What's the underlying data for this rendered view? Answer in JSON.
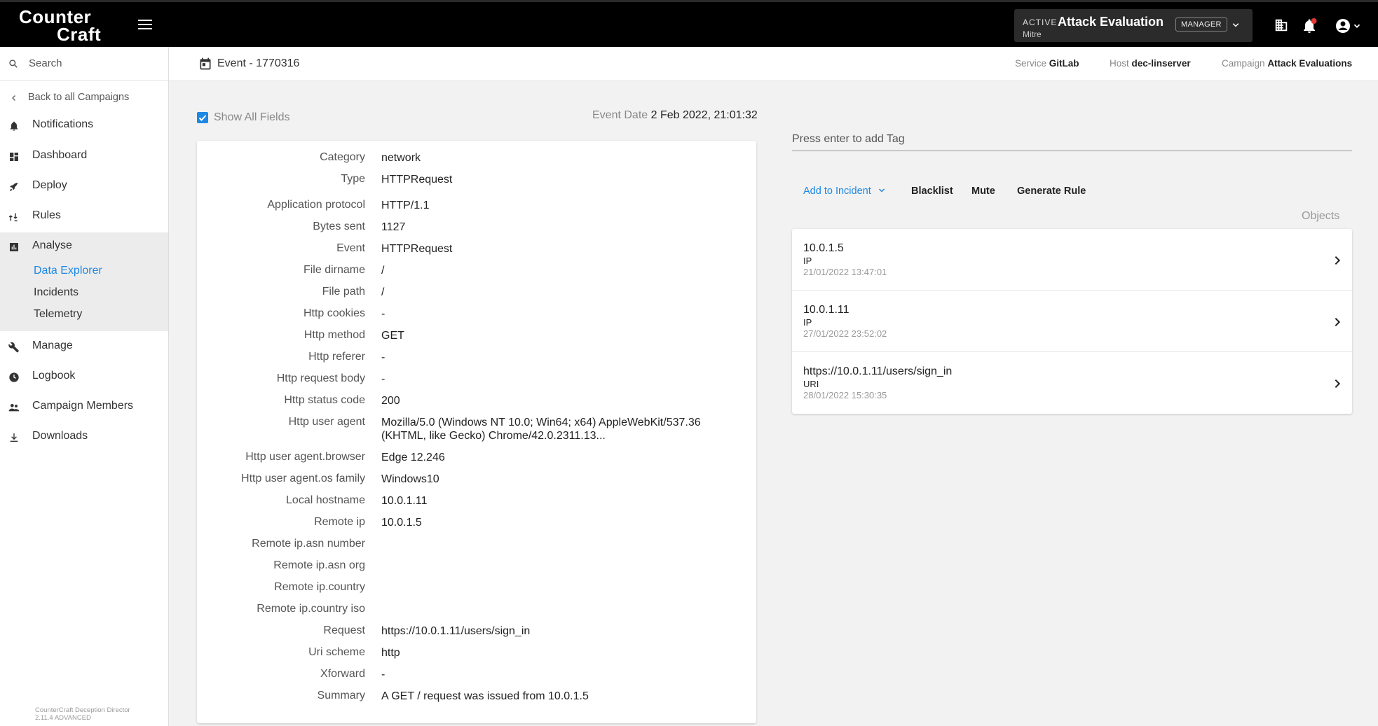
{
  "app": {
    "logo_line1": "Counter",
    "logo_line2": "Craft",
    "version_line1": "CounterCraft Deception Director",
    "version_line2": "2.11.4 ADVANCED"
  },
  "campaign": {
    "status": "ACTIVE",
    "name": "Attack Evaluations",
    "org": "Mitre",
    "role": "MANAGER"
  },
  "sidebar": {
    "search_label": "Search",
    "back_label": "Back to all Campaigns",
    "items": [
      {
        "label": "Notifications",
        "icon": "bell-icon"
      },
      {
        "label": "Dashboard",
        "icon": "dashboard-icon"
      },
      {
        "label": "Deploy",
        "icon": "rocket-icon"
      },
      {
        "label": "Rules",
        "icon": "rules-icon"
      },
      {
        "label": "Analyse",
        "icon": "chart-icon"
      },
      {
        "label": "Manage",
        "icon": "wrench-icon"
      },
      {
        "label": "Logbook",
        "icon": "clock-icon"
      },
      {
        "label": "Campaign Members",
        "icon": "people-icon"
      },
      {
        "label": "Downloads",
        "icon": "download-icon"
      }
    ],
    "analyse_sub": [
      "Data Explorer",
      "Incidents",
      "Telemetry"
    ]
  },
  "header": {
    "title": "Event - 1770316",
    "service_label": "Service",
    "service_value": "GitLab",
    "host_label": "Host",
    "host_value": "dec-linserver",
    "campaign_label": "Campaign",
    "campaign_value": "Attack Evaluations"
  },
  "event": {
    "show_all_fields": "Show All Fields",
    "date_label": "Event Date",
    "date_value": "2 Feb 2022, 21:01:32"
  },
  "fields": [
    {
      "label": "Category",
      "value": "network"
    },
    {
      "label": "Type",
      "value": "HTTPRequest"
    },
    {
      "label": "Application protocol",
      "value": "HTTP/1.1"
    },
    {
      "label": "Bytes sent",
      "value": "1127"
    },
    {
      "label": "Event",
      "value": "HTTPRequest"
    },
    {
      "label": "File dirname",
      "value": "/"
    },
    {
      "label": "File path",
      "value": "/"
    },
    {
      "label": "Http cookies",
      "value": "-"
    },
    {
      "label": "Http method",
      "value": "GET"
    },
    {
      "label": "Http referer",
      "value": "-"
    },
    {
      "label": "Http request body",
      "value": "-"
    },
    {
      "label": "Http status code",
      "value": "200"
    },
    {
      "label": "Http user agent",
      "value": "Mozilla/5.0 (Windows NT 10.0; Win64; x64) AppleWebKit/537.36 (KHTML, like Gecko) Chrome/42.0.2311.13..."
    },
    {
      "label": "Http user agent.browser",
      "value": "Edge 12.246"
    },
    {
      "label": "Http user agent.os family",
      "value": "Windows10"
    },
    {
      "label": "Local hostname",
      "value": "10.0.1.11"
    },
    {
      "label": "Remote ip",
      "value": "10.0.1.5"
    },
    {
      "label": "Remote ip.asn number",
      "value": ""
    },
    {
      "label": "Remote ip.asn org",
      "value": ""
    },
    {
      "label": "Remote ip.country",
      "value": ""
    },
    {
      "label": "Remote ip.country iso",
      "value": ""
    },
    {
      "label": "Request",
      "value": "https://10.0.1.11/users/sign_in"
    },
    {
      "label": "Uri scheme",
      "value": "http"
    },
    {
      "label": "Xforward",
      "value": "-"
    },
    {
      "label": "Summary",
      "value": "A GET / request was issued from 10.0.1.5"
    }
  ],
  "right": {
    "tag_placeholder": "Press enter to add Tag",
    "add_to_incident": "Add to Incident",
    "blacklist": "Blacklist",
    "mute": "Mute",
    "generate_rule": "Generate Rule",
    "objects_label": "Objects",
    "objects": [
      {
        "value": "10.0.1.5",
        "type": "IP",
        "date": "21/01/2022 13:47:01"
      },
      {
        "value": "10.0.1.11",
        "type": "IP",
        "date": "27/01/2022 23:52:02"
      },
      {
        "value": "https://10.0.1.11/users/sign_in",
        "type": "URI",
        "date": "28/01/2022 15:30:35"
      }
    ]
  },
  "colors": {
    "accent": "#1e88e5",
    "topbar": "#000000"
  }
}
